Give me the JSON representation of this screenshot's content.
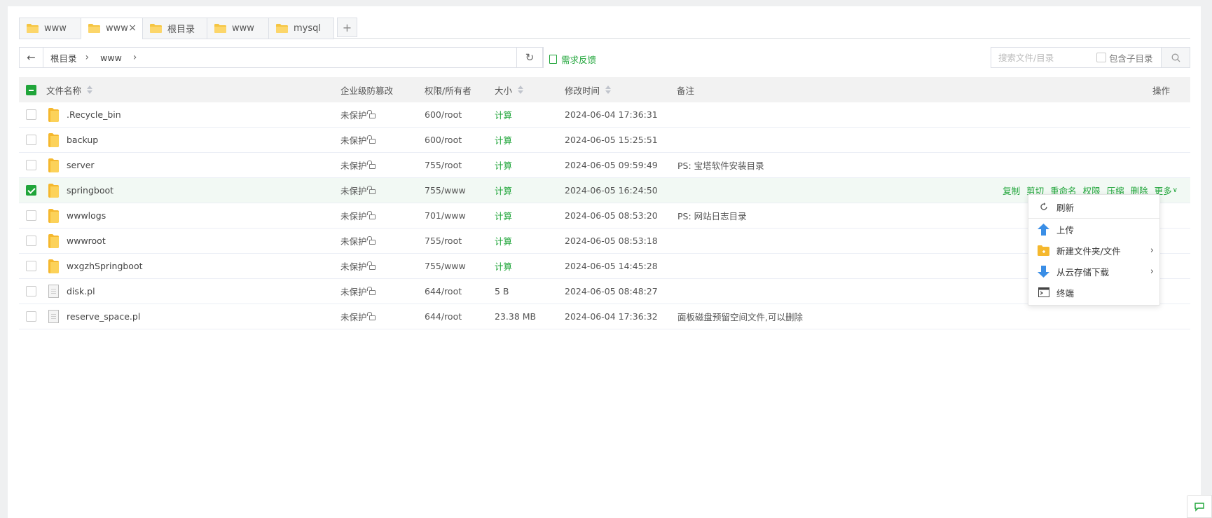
{
  "tabs": [
    {
      "label": "www",
      "active": false
    },
    {
      "label": "www",
      "active": true,
      "close": "×"
    },
    {
      "label": "根目录",
      "active": false
    },
    {
      "label": "www",
      "active": false
    },
    {
      "label": "mysql",
      "active": false
    }
  ],
  "tab_add_label": "+",
  "path": {
    "back": "←",
    "crumbs": [
      "根目录",
      "www"
    ],
    "sep": "›",
    "refresh": "↻"
  },
  "feedback_label": "需求反馈",
  "search": {
    "placeholder": "搜索文件/目录",
    "subdir_label": "包含子目录"
  },
  "table": {
    "headers": {
      "name": "文件名称",
      "protect": "企业级防篡改",
      "perm": "权限/所有者",
      "size": "大小",
      "mtime": "修改时间",
      "note": "备注",
      "ops": "操作"
    },
    "rows": [
      {
        "name": ".Recycle_bin",
        "type": "folder",
        "protect": "未保护",
        "perm": "600/root",
        "size": "计算",
        "mtime": "2024-06-04 17:36:31",
        "note": "",
        "checked": false
      },
      {
        "name": "backup",
        "type": "folder",
        "protect": "未保护",
        "perm": "600/root",
        "size": "计算",
        "mtime": "2024-06-05 15:25:51",
        "note": "",
        "checked": false
      },
      {
        "name": "server",
        "type": "folder",
        "protect": "未保护",
        "perm": "755/root",
        "size": "计算",
        "mtime": "2024-06-05 09:59:49",
        "note": "PS: 宝塔软件安装目录",
        "checked": false
      },
      {
        "name": "springboot",
        "type": "folder",
        "protect": "未保护",
        "perm": "755/www",
        "size": "计算",
        "mtime": "2024-06-05 16:24:50",
        "note": "",
        "checked": true
      },
      {
        "name": "wwwlogs",
        "type": "folder",
        "protect": "未保护",
        "perm": "701/www",
        "size": "计算",
        "mtime": "2024-06-05 08:53:20",
        "note": "PS: 网站日志目录",
        "checked": false
      },
      {
        "name": "wwwroot",
        "type": "folder",
        "protect": "未保护",
        "perm": "755/root",
        "size": "计算",
        "mtime": "2024-06-05 08:53:18",
        "note": "",
        "checked": false
      },
      {
        "name": "wxgzhSpringboot",
        "type": "folder",
        "protect": "未保护",
        "perm": "755/www",
        "size": "计算",
        "mtime": "2024-06-05 14:45:28",
        "note": "",
        "checked": false
      },
      {
        "name": "disk.pl",
        "type": "file",
        "protect": "未保护",
        "perm": "644/root",
        "size": "5 B",
        "mtime": "2024-06-05 08:48:27",
        "note": "",
        "checked": false
      },
      {
        "name": "reserve_space.pl",
        "type": "file",
        "protect": "未保护",
        "perm": "644/root",
        "size": "23.38 MB",
        "mtime": "2024-06-04 17:36:32",
        "note": "面板磁盘预留空间文件,可以删除",
        "checked": false
      }
    ],
    "row_ops": [
      "复制",
      "剪切",
      "重命名",
      "权限",
      "压缩",
      "删除",
      "更多"
    ]
  },
  "context_menu": {
    "items": [
      {
        "label": "刷新",
        "icon": "refresh-icon"
      },
      {
        "label": "上传",
        "icon": "upload-arrow-icon"
      },
      {
        "label": "新建文件夹/文件",
        "icon": "new-folder-icon",
        "submenu": true
      },
      {
        "label": "从云存储下载",
        "icon": "download-arrow-icon",
        "submenu": true
      },
      {
        "label": "终端",
        "icon": "terminal-icon"
      }
    ],
    "arrow": "›"
  },
  "colors": {
    "accent": "#20a53a",
    "folder": "#f5c542"
  }
}
